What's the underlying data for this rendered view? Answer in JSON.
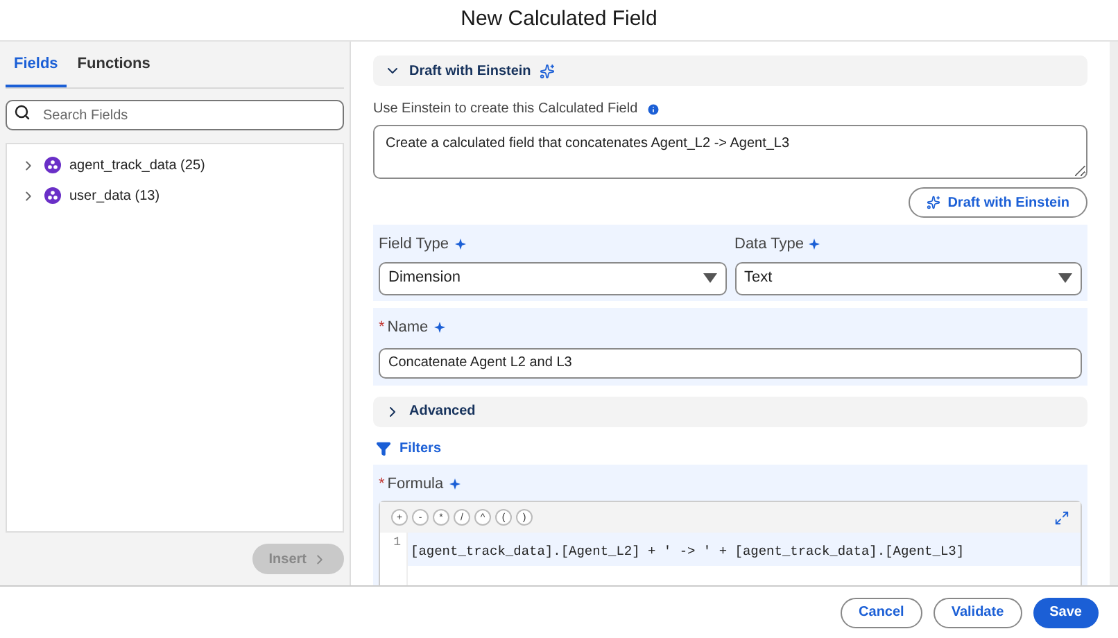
{
  "window": {
    "title": "New Calculated Field"
  },
  "tabs": [
    {
      "label": "Fields",
      "selected": true
    },
    {
      "label": "Functions",
      "selected": false
    }
  ],
  "search": {
    "placeholder": "Search Fields"
  },
  "tree": [
    {
      "label": "agent_track_data (25)",
      "expanded": false
    },
    {
      "label": "user_data (13)",
      "expanded": false
    }
  ],
  "insert_button": {
    "label": "Insert",
    "disabled": true
  },
  "einstein": {
    "header": "Draft with Einstein",
    "expanded": true,
    "prompt_label": "Use Einstein to create this Calculated Field",
    "prompt": "Create a calculated field that concatenates Agent_L2 -> Agent_L3",
    "button": "Draft with Einstein"
  },
  "field_type": {
    "label": "Field Type",
    "value": "Dimension"
  },
  "data_type": {
    "label": "Data Type",
    "value": "Text"
  },
  "name": {
    "label": "Name",
    "required": true,
    "value": "Concatenate Agent L2 and L3"
  },
  "advanced": {
    "label": "Advanced",
    "expanded": false
  },
  "filters": {
    "label": "Filters"
  },
  "formula": {
    "label": "Formula",
    "required": true,
    "operators": [
      "+",
      "-",
      "*",
      "/",
      "^",
      "(",
      ")"
    ],
    "lines": [
      {
        "number": "1",
        "text": "[agent_track_data].[Agent_L2] + ' -> ' + [agent_track_data].[Agent_L3]"
      }
    ]
  },
  "footer": {
    "buttons": [
      {
        "label": "Cancel",
        "kind": "outline"
      },
      {
        "label": "Validate",
        "kind": "outline"
      },
      {
        "label": "Save",
        "kind": "primary"
      }
    ]
  }
}
